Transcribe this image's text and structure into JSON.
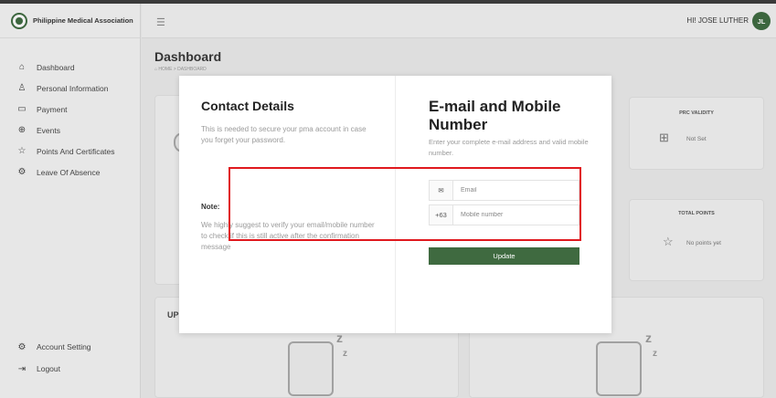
{
  "brand": {
    "name": "Philippine Medical Association"
  },
  "sidebar": {
    "items": [
      {
        "label": "Dashboard",
        "icon": "home-icon"
      },
      {
        "label": "Personal Information",
        "icon": "user-icon"
      },
      {
        "label": "Payment",
        "icon": "card-icon"
      },
      {
        "label": "Events",
        "icon": "globe-icon"
      },
      {
        "label": "Points And Certificates",
        "icon": "star-icon"
      },
      {
        "label": "Leave Of Absence",
        "icon": "gear-icon"
      }
    ],
    "bottom": [
      {
        "label": "Account Setting",
        "icon": "settings-icon"
      },
      {
        "label": "Logout",
        "icon": "logout-icon"
      }
    ]
  },
  "header": {
    "greeting": "HI! JOSE LUTHER",
    "avatar_initials": "JL"
  },
  "page": {
    "title": "Dashboard",
    "breadcrumb": "⌂ HOME > DASHBOARD"
  },
  "cards": {
    "prc": {
      "title": "PRC VALIDITY",
      "text": "Not Set"
    },
    "points": {
      "title": "TOTAL POINTS",
      "text": "No points yet"
    },
    "upcoming_partial": "UP"
  },
  "modal": {
    "left": {
      "title": "Contact Details",
      "description": "This is needed to secure your pma account in case you forget your password.",
      "note_title": "Note:",
      "note_text": "We highly suggest to verify your email/mobile number to check if this is still active after the confirmation message"
    },
    "right": {
      "title": "E-mail and Mobile Number",
      "description": "Enter your complete e-mail address and valid mobile number.",
      "email_placeholder": "Email",
      "mobile_prefix": "+63",
      "mobile_placeholder": "Mobile number",
      "update_label": "Update"
    }
  },
  "colors": {
    "brand": "#3f6a40",
    "highlight": "#e0191e"
  }
}
